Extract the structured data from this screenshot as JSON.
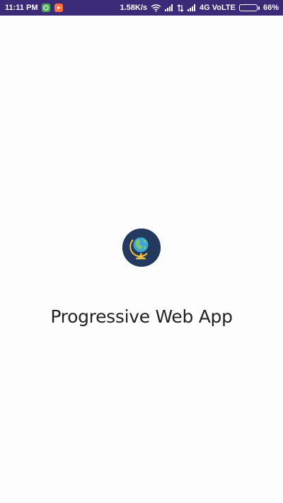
{
  "status_bar": {
    "time": "11:11 PM",
    "network_speed": "1.58K/s",
    "network_type": "4G VoLTE",
    "battery_percent": "66%",
    "battery_level": 0.66,
    "icons": [
      "app-notification-green-icon",
      "video-app-icon",
      "wifi-icon",
      "signal-icon",
      "data-transfer-icon",
      "signal-icon",
      "battery-icon"
    ]
  },
  "splash": {
    "title": "Progressive Web App",
    "logo_icon": "globe-icon",
    "background_color": "#fdfdfd",
    "logo_background": "#233a5e"
  }
}
